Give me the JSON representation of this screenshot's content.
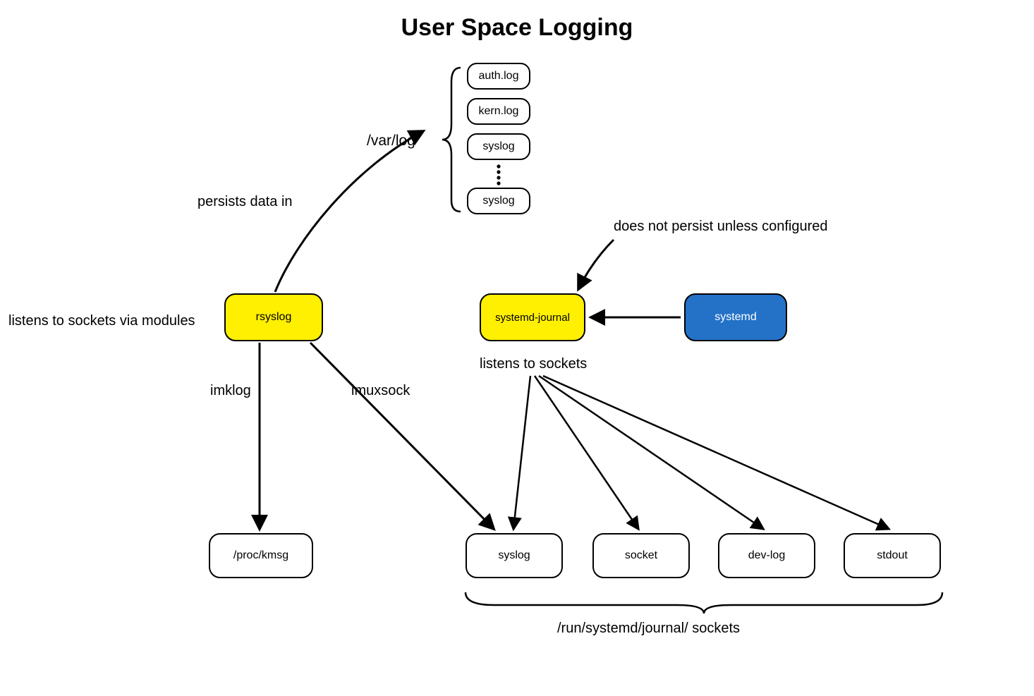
{
  "title": "User Space Logging",
  "labels": {
    "varlog": "/var/log",
    "persists": "persists data in",
    "listens_modules": "listens to sockets via modules",
    "doesnot": "does not persist unless configured",
    "listens_sockets": "listens to sockets",
    "imklog": "imklog",
    "imuxsock": "imuxsock",
    "run_sockets": "/run/systemd/journal/ sockets"
  },
  "nodes": {
    "authlog": "auth.log",
    "kernlog": "kern.log",
    "syslog1": "syslog",
    "syslog2": "syslog",
    "rsyslog": "rsyslog",
    "journal": "systemd-journal",
    "systemd": "systemd",
    "prockmsg": "/proc/kmsg",
    "sock_syslog": "syslog",
    "sock_socket": "socket",
    "sock_devlog": "dev-log",
    "sock_stdout": "stdout"
  },
  "colors": {
    "yellow": "#ffef00",
    "blue": "#2472c8"
  }
}
